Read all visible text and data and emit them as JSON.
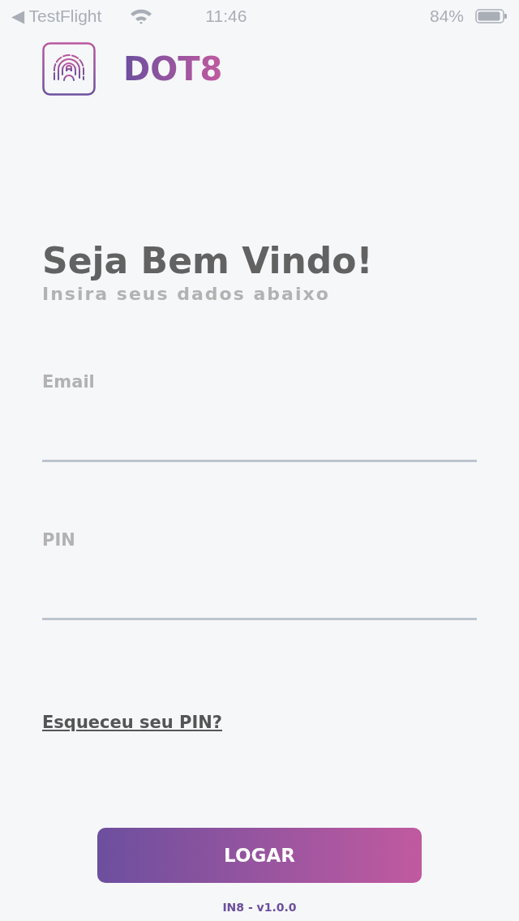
{
  "status_bar": {
    "back_app": "◀ TestFlight",
    "time": "11:46",
    "battery": "84%"
  },
  "brand": {
    "name": "DOT8"
  },
  "heading": {
    "title": "Seja Bem Vindo!",
    "subtitle": "Insira seus dados abaixo"
  },
  "fields": [
    {
      "label": "Email"
    },
    {
      "label": "PIN"
    }
  ],
  "forgot_link": "Esqueceu seu PIN?",
  "login_button": "LOGAR",
  "version": "IN8 - v1.0.0"
}
